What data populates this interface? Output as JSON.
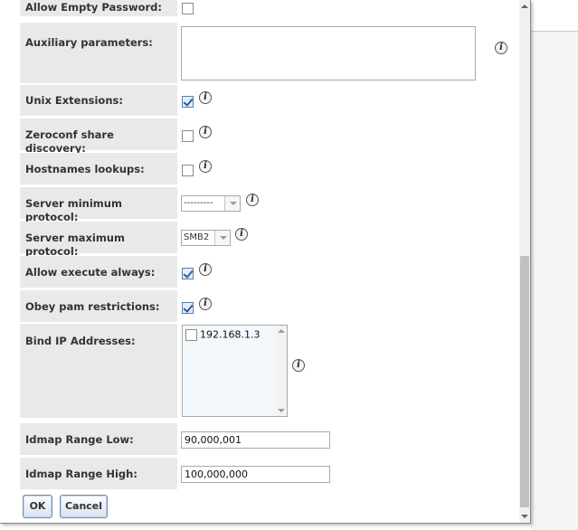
{
  "form": {
    "allow_empty_password": {
      "label": "Allow Empty Password:",
      "checked": false
    },
    "auxiliary_parameters": {
      "label": "Auxiliary parameters:",
      "value": ""
    },
    "unix_extensions": {
      "label": "Unix Extensions:",
      "checked": true
    },
    "zeroconf": {
      "label": "Zeroconf share discovery:",
      "checked": false
    },
    "hostnames_lookups": {
      "label": "Hostnames lookups:",
      "checked": false
    },
    "server_min_protocol": {
      "label": "Server minimum protocol:",
      "value": "---------"
    },
    "server_max_protocol": {
      "label": "Server maximum protocol:",
      "value": "SMB2"
    },
    "allow_execute_always": {
      "label": "Allow execute always:",
      "checked": true
    },
    "obey_pam": {
      "label": "Obey pam restrictions:",
      "checked": true
    },
    "bind_ip": {
      "label": "Bind IP Addresses:",
      "options": [
        {
          "label": "192.168.1.3",
          "checked": false
        }
      ]
    },
    "idmap_low": {
      "label": "Idmap Range Low:",
      "value": "90,000,001"
    },
    "idmap_high": {
      "label": "Idmap Range High:",
      "value": "100,000,000"
    }
  },
  "buttons": {
    "ok": "OK",
    "cancel": "Cancel"
  },
  "icons": {
    "info": "info-icon"
  },
  "colors": {
    "label_bg": "#e9e9e9",
    "button_border": "#6f8db5"
  }
}
